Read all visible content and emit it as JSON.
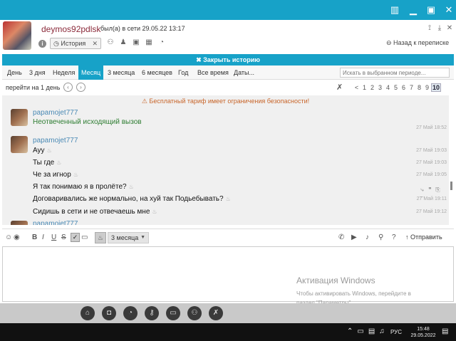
{
  "titlebar": {
    "color": "#17a2c8",
    "buttons": [
      "columns-icon",
      "minimize-icon",
      "restore-icon",
      "close-icon"
    ]
  },
  "contact": {
    "name": "deymos92pdlsk",
    "status": "был(а) в сети 29.05.22 13:17",
    "history_tab": "История",
    "back_link": "Назад к переписке"
  },
  "history_bar": {
    "label": "✖ Закрыть историю"
  },
  "period_tabs": [
    {
      "label": "День"
    },
    {
      "label": "3 дня"
    },
    {
      "label": "Неделя"
    },
    {
      "label": "Месяц",
      "active": true
    },
    {
      "label": "3 месяца"
    },
    {
      "label": "6 месяцев"
    },
    {
      "label": "Год"
    },
    {
      "label": "Все время"
    },
    {
      "label": "Даты..."
    }
  ],
  "search": {
    "placeholder": "Искать в выбранном периоде..."
  },
  "paging": {
    "goto_label": "перейти на 1 день",
    "pages": [
      "<",
      "1",
      "2",
      "3",
      "4",
      "5",
      "6",
      "7",
      "8",
      "9",
      "10"
    ],
    "current": "10"
  },
  "chat": {
    "warning": "⚠ Бесплатный тариф имеет ограничения безопасности!",
    "block1": {
      "author": "papamojet777",
      "text": "Неотвеченный исходящий вызов",
      "time": "27 Май 18:52"
    },
    "block2": {
      "author": "papamojet777",
      "messages": [
        {
          "text": "Ауу",
          "time": "27 Май 19:03"
        },
        {
          "text": "Ты где",
          "time": "27 Май 19:03"
        },
        {
          "text": "Че за игнор",
          "time": "27 Май 19:05"
        },
        {
          "text": "Я так понимаю я в пролёте?",
          "time": "27 Май 19:05"
        },
        {
          "text": "Договаривались же нормально, на хуй так Подьебывать?",
          "time": "27 Май 19:11"
        },
        {
          "text": "Сидишь в сети и не отвечаешь мне",
          "time": "27 Май 19:12"
        }
      ]
    },
    "block3": {
      "author": "papamojet777"
    }
  },
  "composer": {
    "format": [
      "B",
      "I",
      "U",
      "S"
    ],
    "period_value": "3 месяца",
    "send_label": "Отправить"
  },
  "activation": {
    "title": "Активация Windows",
    "line1": "Чтобы активировать Windows, перейдите в",
    "line2": "раздел \"Параметры\"."
  },
  "taskbar": {
    "lang": "РУС",
    "time": "15:48",
    "date": "29.05.2022"
  }
}
